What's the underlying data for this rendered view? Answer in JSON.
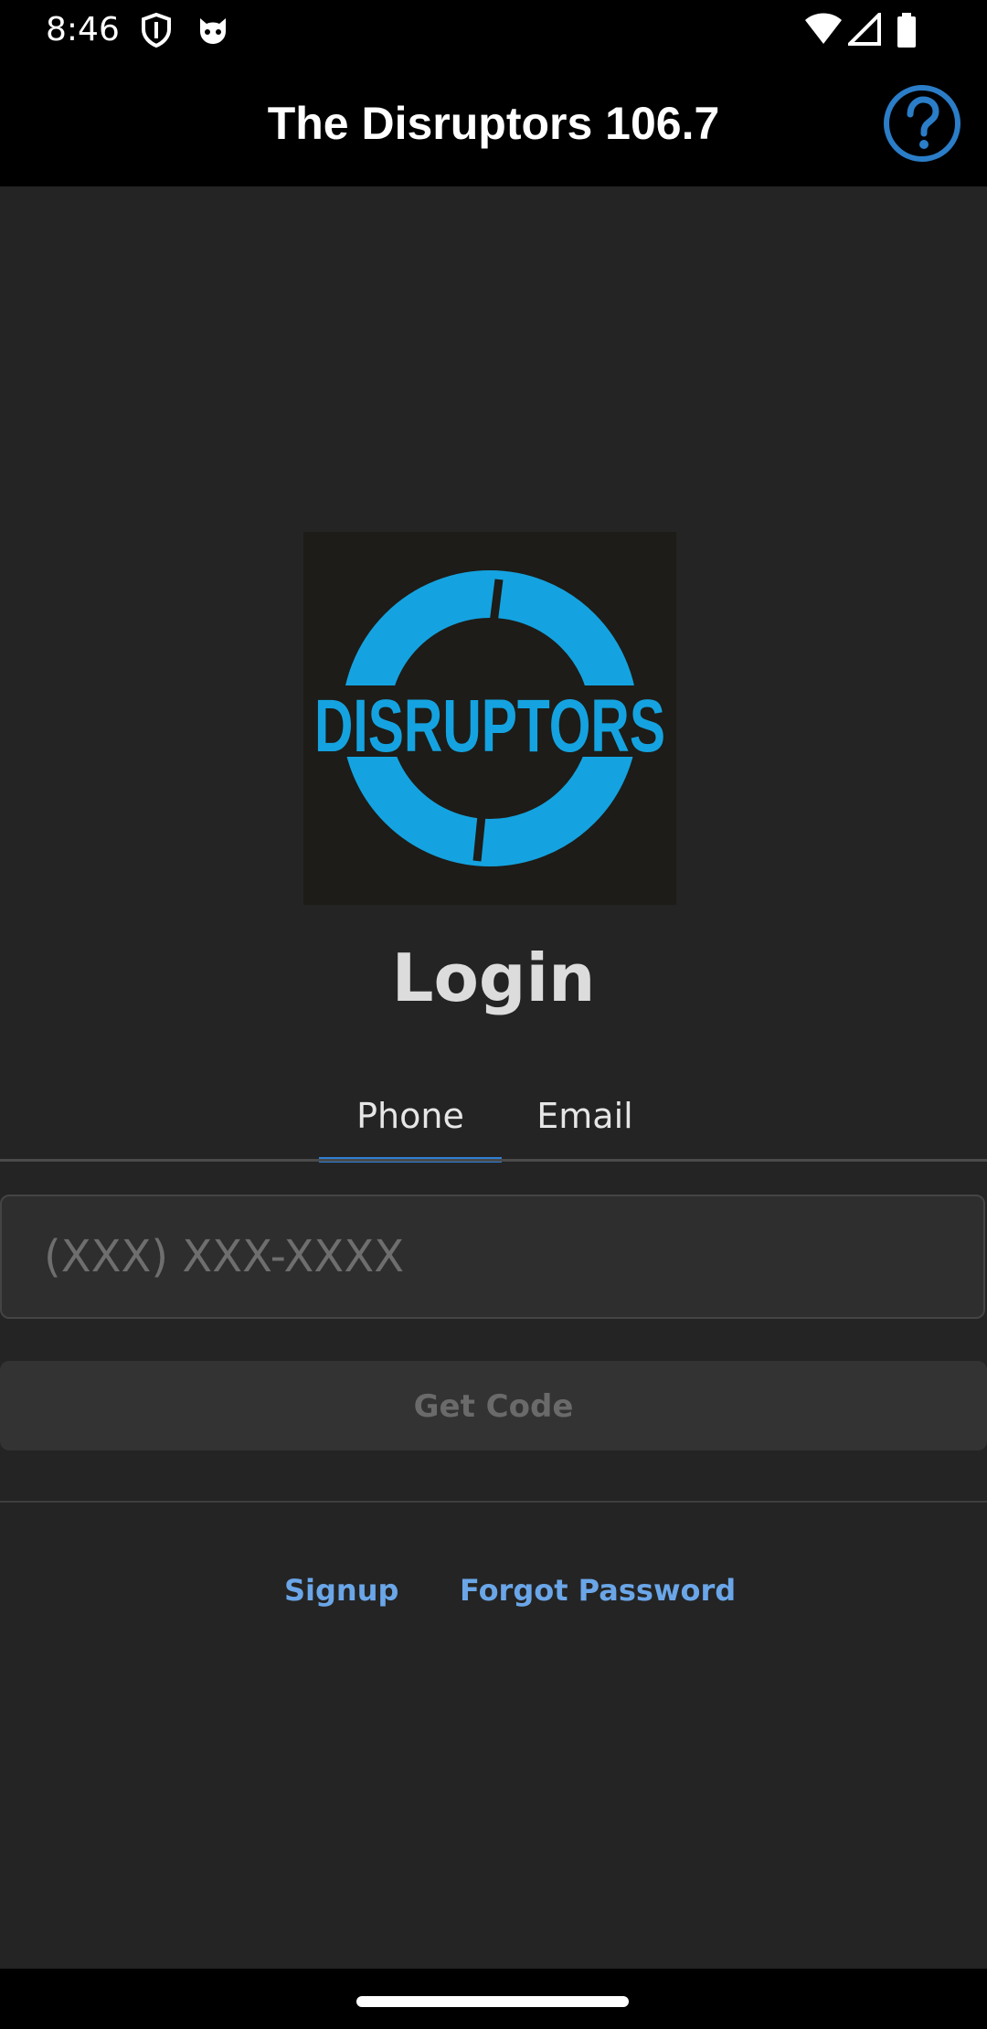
{
  "status_bar": {
    "time": "8:46",
    "icons": [
      "shield-icon",
      "cat-face-icon",
      "wifi-icon",
      "signal-icon",
      "battery-icon"
    ]
  },
  "app_bar": {
    "title": "The Disruptors 106.7",
    "help_icon": "help-circle-icon"
  },
  "logo": {
    "text": "DISRUPTORS",
    "color": "#14a3e0"
  },
  "login": {
    "title": "Login",
    "tabs": [
      {
        "label": "Phone",
        "active": true
      },
      {
        "label": "Email",
        "active": false
      }
    ],
    "phone_placeholder": "(XXX) XXX-XXXX",
    "get_code_label": "Get Code",
    "signup_label": "Signup",
    "forgot_password_label": "Forgot Password"
  },
  "colors": {
    "accent": "#2f7fd6",
    "link": "#6aa6e8",
    "background": "#242424"
  }
}
